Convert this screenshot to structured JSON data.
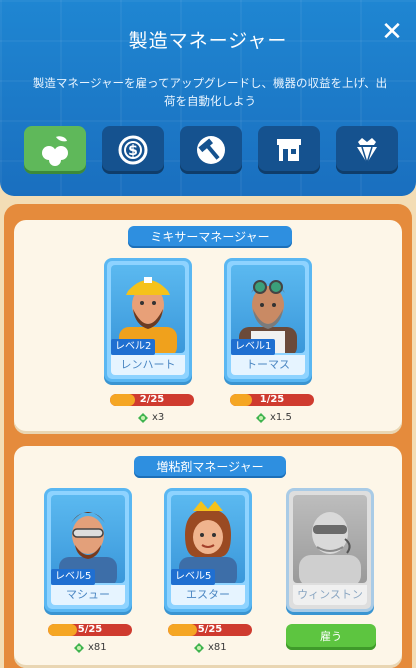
{
  "header": {
    "title": "製造マネージャー",
    "description_line1": "製造マネージャーを雇ってアップグレードし、機器の収益を上げ、出",
    "description_line2": "荷を自動化しよう",
    "close_icon": "close-icon",
    "categories": [
      {
        "icon": "berries-icon",
        "active": true
      },
      {
        "icon": "coin-icon",
        "active": false
      },
      {
        "icon": "hammer-icon",
        "active": false
      },
      {
        "icon": "shop-icon",
        "active": false
      },
      {
        "icon": "diamond-crown-icon",
        "active": false
      }
    ]
  },
  "mixer": {
    "title": "ミキサーマネージャー",
    "managers": [
      {
        "name": "レンハート",
        "level": "レベル2",
        "progress": "2/25",
        "progress_fraction": 0.08,
        "reward": "x3"
      },
      {
        "name": "トーマス",
        "level": "レベル1",
        "progress": "1/25",
        "progress_fraction": 0.04,
        "reward": "x1.5"
      }
    ]
  },
  "thickener": {
    "title": "増粘剤マネージャー",
    "managers": [
      {
        "name": "マシュー",
        "level": "レベル5",
        "progress": "5/25",
        "progress_fraction": 0.2,
        "reward": "x81"
      },
      {
        "name": "エスター",
        "level": "レベル5",
        "progress": "5/25",
        "progress_fraction": 0.2,
        "reward": "x81"
      },
      {
        "name": "ウィンストン",
        "locked": true,
        "hire_label": "雇う"
      }
    ]
  },
  "colors": {
    "header": "#1f86d2",
    "panel": "#e58b3c",
    "active_tab": "#5fb85a",
    "progress_fill": "#f5a623",
    "progress_bg": "#cf3b2f"
  }
}
